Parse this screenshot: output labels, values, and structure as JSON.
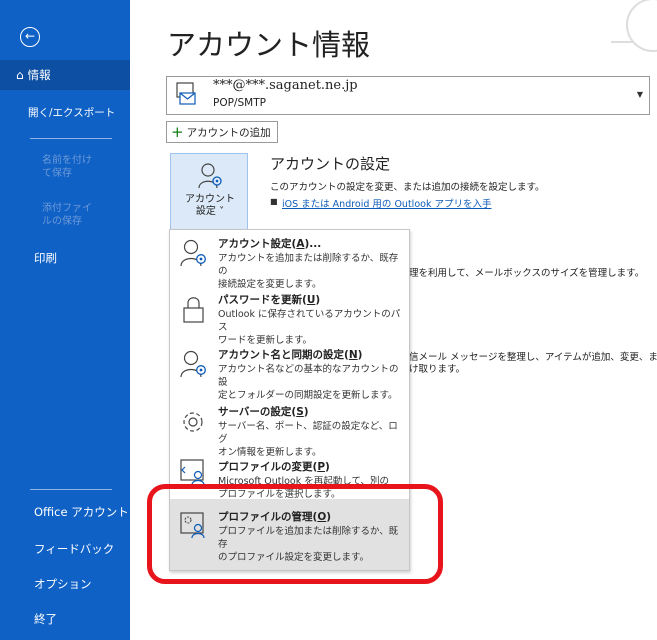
{
  "sidebar": {
    "back_icon": "back-arrow-icon",
    "home_icon": "home-icon",
    "items": [
      {
        "label": "情報"
      },
      {
        "label": "開く/エクスポート"
      },
      {
        "label": "名前を付けて保存"
      },
      {
        "label": "添付ファイルの保存"
      },
      {
        "label": "印刷"
      },
      {
        "label": "Office アカウント"
      },
      {
        "label": "フィードバック"
      },
      {
        "label": "オプション"
      },
      {
        "label": "終了"
      }
    ]
  },
  "main": {
    "title": "アカウント情報",
    "account": {
      "email": "***@***.saganet.ne.jp",
      "type": "POP/SMTP"
    },
    "add_account": "アカウントの追加",
    "settings_tile": {
      "line1": "アカウント",
      "line2": "設定 ˅"
    },
    "section": {
      "title": "アカウントの設定",
      "desc": "このアカウントの設定を変更、または追加の接続を設定します。",
      "link": "iOS または Android 用の Outlook アプリを入手"
    },
    "bg_texts": [
      "理を利用して、メールボックスのサイズを管理します。",
      "信メール メッセージを整理し、アイテムが追加、変更、ま",
      "け取ります。"
    ]
  },
  "menu": {
    "items": [
      {
        "title": "アカウント設定(",
        "key": "A",
        "suffix": ")...",
        "desc1": "アカウントを追加または削除するか、既存の",
        "desc2": "接続設定を変更します。"
      },
      {
        "title": "パスワードを更新(",
        "key": "U",
        "suffix": ")",
        "desc1": "Outlook に保存されているアカウントのパス",
        "desc2": "ワードを更新します。"
      },
      {
        "title": "アカウント名と同期の設定(",
        "key": "N",
        "suffix": ")",
        "desc1": "アカウント名などの基本的なアカウントの設",
        "desc2": "定とフォルダーの同期設定を更新します。"
      },
      {
        "title": "サーバーの設定(",
        "key": "S",
        "suffix": ")",
        "desc1": "サーバー名、ポート、認証の設定など、ログ",
        "desc2": "オン情報を更新します。"
      },
      {
        "title": "プロファイルの変更(",
        "key": "P",
        "suffix": ")",
        "desc1": "Microsoft Outlook を再起動して、別の",
        "desc2": "プロファイルを選択します。"
      },
      {
        "title": "プロファイルの管理(",
        "key": "O",
        "suffix": ")",
        "desc1": "プロファイルを追加または削除するか、既存",
        "desc2": "のプロファイル設定を変更します。"
      }
    ]
  },
  "colors": {
    "sidebar": "#0f61c6",
    "highlight": "#e8141b",
    "link": "#0c5bb8"
  }
}
